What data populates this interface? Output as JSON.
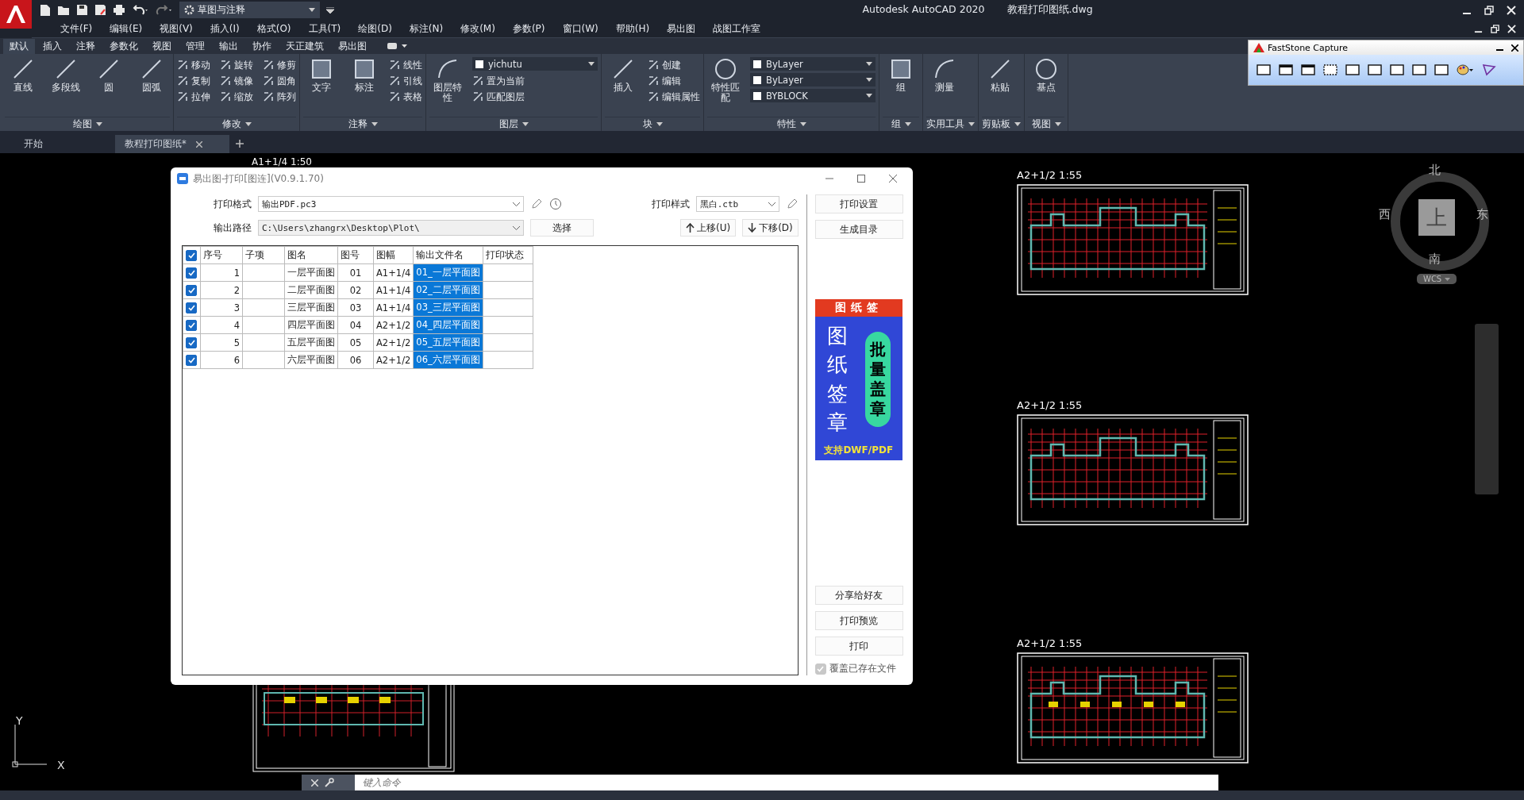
{
  "titlebar": {
    "workspace": "草图与注释",
    "app_title": "Autodesk AutoCAD 2020",
    "file_title": "教程打印图纸.dwg"
  },
  "menu": [
    "文件(F)",
    "编辑(E)",
    "视图(V)",
    "插入(I)",
    "格式(O)",
    "工具(T)",
    "绘图(D)",
    "标注(N)",
    "修改(M)",
    "参数(P)",
    "窗口(W)",
    "帮助(H)",
    "易出图",
    "战图工作室"
  ],
  "ribbon_tabs": [
    {
      "label": "默认",
      "selected": true
    },
    {
      "label": "插入",
      "selected": false
    },
    {
      "label": "注释",
      "selected": false
    },
    {
      "label": "参数化",
      "selected": false
    },
    {
      "label": "视图",
      "selected": false
    },
    {
      "label": "管理",
      "selected": false
    },
    {
      "label": "输出",
      "selected": false
    },
    {
      "label": "协作",
      "selected": false
    },
    {
      "label": "天正建筑",
      "selected": false
    },
    {
      "label": "易出图",
      "selected": false
    }
  ],
  "ribbon_panels": [
    {
      "title": "绘图",
      "tools": [
        {
          "kind": "large",
          "label": "直线"
        },
        {
          "kind": "large",
          "label": "多段线"
        },
        {
          "kind": "large",
          "label": "圆"
        },
        {
          "kind": "large",
          "label": "圆弧"
        }
      ]
    },
    {
      "title": "修改",
      "tools": [
        {
          "kind": "small",
          "label": "移动"
        },
        {
          "kind": "small",
          "label": "复制"
        },
        {
          "kind": "small",
          "label": "拉伸"
        },
        {
          "kind": "small",
          "label": "旋转"
        },
        {
          "kind": "small",
          "label": "镜像"
        },
        {
          "kind": "small",
          "label": "缩放"
        },
        {
          "kind": "small",
          "label": "修剪"
        },
        {
          "kind": "small",
          "label": "圆角"
        },
        {
          "kind": "small",
          "label": "阵列"
        }
      ]
    },
    {
      "title": "注释",
      "tools": [
        {
          "kind": "large",
          "label": "文字"
        },
        {
          "kind": "large",
          "label": "标注"
        },
        {
          "kind": "small",
          "label": "线性"
        },
        {
          "kind": "small",
          "label": "引线"
        },
        {
          "kind": "small",
          "label": "表格"
        }
      ]
    },
    {
      "title": "图层",
      "tools": [
        {
          "kind": "large",
          "label": "图层特性"
        },
        {
          "kind": "dropdown",
          "label": "yichutu"
        },
        {
          "kind": "small",
          "label": "置为当前"
        },
        {
          "kind": "small",
          "label": "匹配图层"
        }
      ]
    },
    {
      "title": "块",
      "tools": [
        {
          "kind": "large",
          "label": "插入"
        },
        {
          "kind": "small",
          "label": "创建"
        },
        {
          "kind": "small",
          "label": "编辑"
        },
        {
          "kind": "small",
          "label": "编辑属性"
        }
      ]
    },
    {
      "title": "特性",
      "tools": [
        {
          "kind": "large",
          "label": "特性匹配"
        },
        {
          "kind": "dropdown",
          "label": "ByLayer"
        },
        {
          "kind": "dropdown",
          "label": "ByLayer"
        },
        {
          "kind": "dropdown",
          "label": "BYBLOCK"
        }
      ]
    },
    {
      "title": "组",
      "tools": [
        {
          "kind": "large",
          "label": "组"
        }
      ]
    },
    {
      "title": "实用工具",
      "tools": [
        {
          "kind": "large",
          "label": "测量"
        }
      ]
    },
    {
      "title": "剪贴板",
      "tools": [
        {
          "kind": "large",
          "label": "粘贴"
        }
      ]
    },
    {
      "title": "视图",
      "tools": [
        {
          "kind": "large",
          "label": "基点"
        }
      ]
    }
  ],
  "doc_tabs": [
    {
      "label": "开始",
      "selected": false
    },
    {
      "label": "教程打印图纸*",
      "selected": true
    }
  ],
  "faststone": {
    "title": "FastStone Capture"
  },
  "canvas": {
    "viewport_label": "A1+1/4 1:50",
    "sheets": [
      {
        "label": "A2+1/2 1:55"
      },
      {
        "label": "A2+1/2 1:55"
      },
      {
        "label": "A2+1/2 1:55"
      }
    ],
    "compass": {
      "north": "北",
      "south": "南",
      "east": "东",
      "west": "西",
      "center": "上",
      "ucs": "WCS"
    },
    "axis_y": "Y",
    "axis_x": "X"
  },
  "command_line": {
    "placeholder": "键入命令"
  },
  "dialog": {
    "title": "易出图-打印[图连](V0.9.1.70)",
    "print_format": {
      "label": "打印格式",
      "value": "输出PDF.pc3"
    },
    "output_path": {
      "label": "输出路径",
      "value": "C:\\Users\\zhangrx\\Desktop\\Plot\\"
    },
    "choose_button": "选择",
    "print_style": {
      "label": "打印样式",
      "value": "黑白.ctb"
    },
    "move_up": "上移(U)",
    "move_down": "下移(D)",
    "table": {
      "all_checked": true,
      "columns": [
        "序号",
        "子项",
        "图名",
        "图号",
        "图幅",
        "输出文件名",
        "打印状态"
      ],
      "rows": [
        {
          "checked": true,
          "no": "1",
          "name": "一层平面图",
          "code": "01",
          "size": "A1+1/4",
          "file": "01_一层平面图",
          "selected": true
        },
        {
          "checked": true,
          "no": "2",
          "name": "二层平面图",
          "code": "02",
          "size": "A1+1/4",
          "file": "02_二层平面图",
          "selected": true
        },
        {
          "checked": true,
          "no": "3",
          "name": "三层平面图",
          "code": "03",
          "size": "A1+1/4",
          "file": "03_三层平面图",
          "selected": true
        },
        {
          "checked": true,
          "no": "4",
          "name": "四层平面图",
          "code": "04",
          "size": "A2+1/2",
          "file": "04_四层平面图",
          "selected": true
        },
        {
          "checked": true,
          "no": "5",
          "name": "五层平面图",
          "code": "05",
          "size": "A2+1/2",
          "file": "05_五层平面图",
          "selected": true
        },
        {
          "checked": true,
          "no": "6",
          "name": "六层平面图",
          "code": "06",
          "size": "A2+1/2",
          "file": "06_六层平面图",
          "selected": true
        }
      ]
    },
    "side_buttons_top": [
      "打印设置",
      "生成目录"
    ],
    "banner": {
      "header": "图纸签",
      "main": "图纸签章",
      "pill": "批量盖章",
      "footer": "支持DWF/PDF"
    },
    "side_buttons_bottom": [
      "分享给好友",
      "打印预览",
      "打印"
    ],
    "overwrite": {
      "label": "覆盖已存在文件",
      "checked": true,
      "disabled": true
    }
  }
}
